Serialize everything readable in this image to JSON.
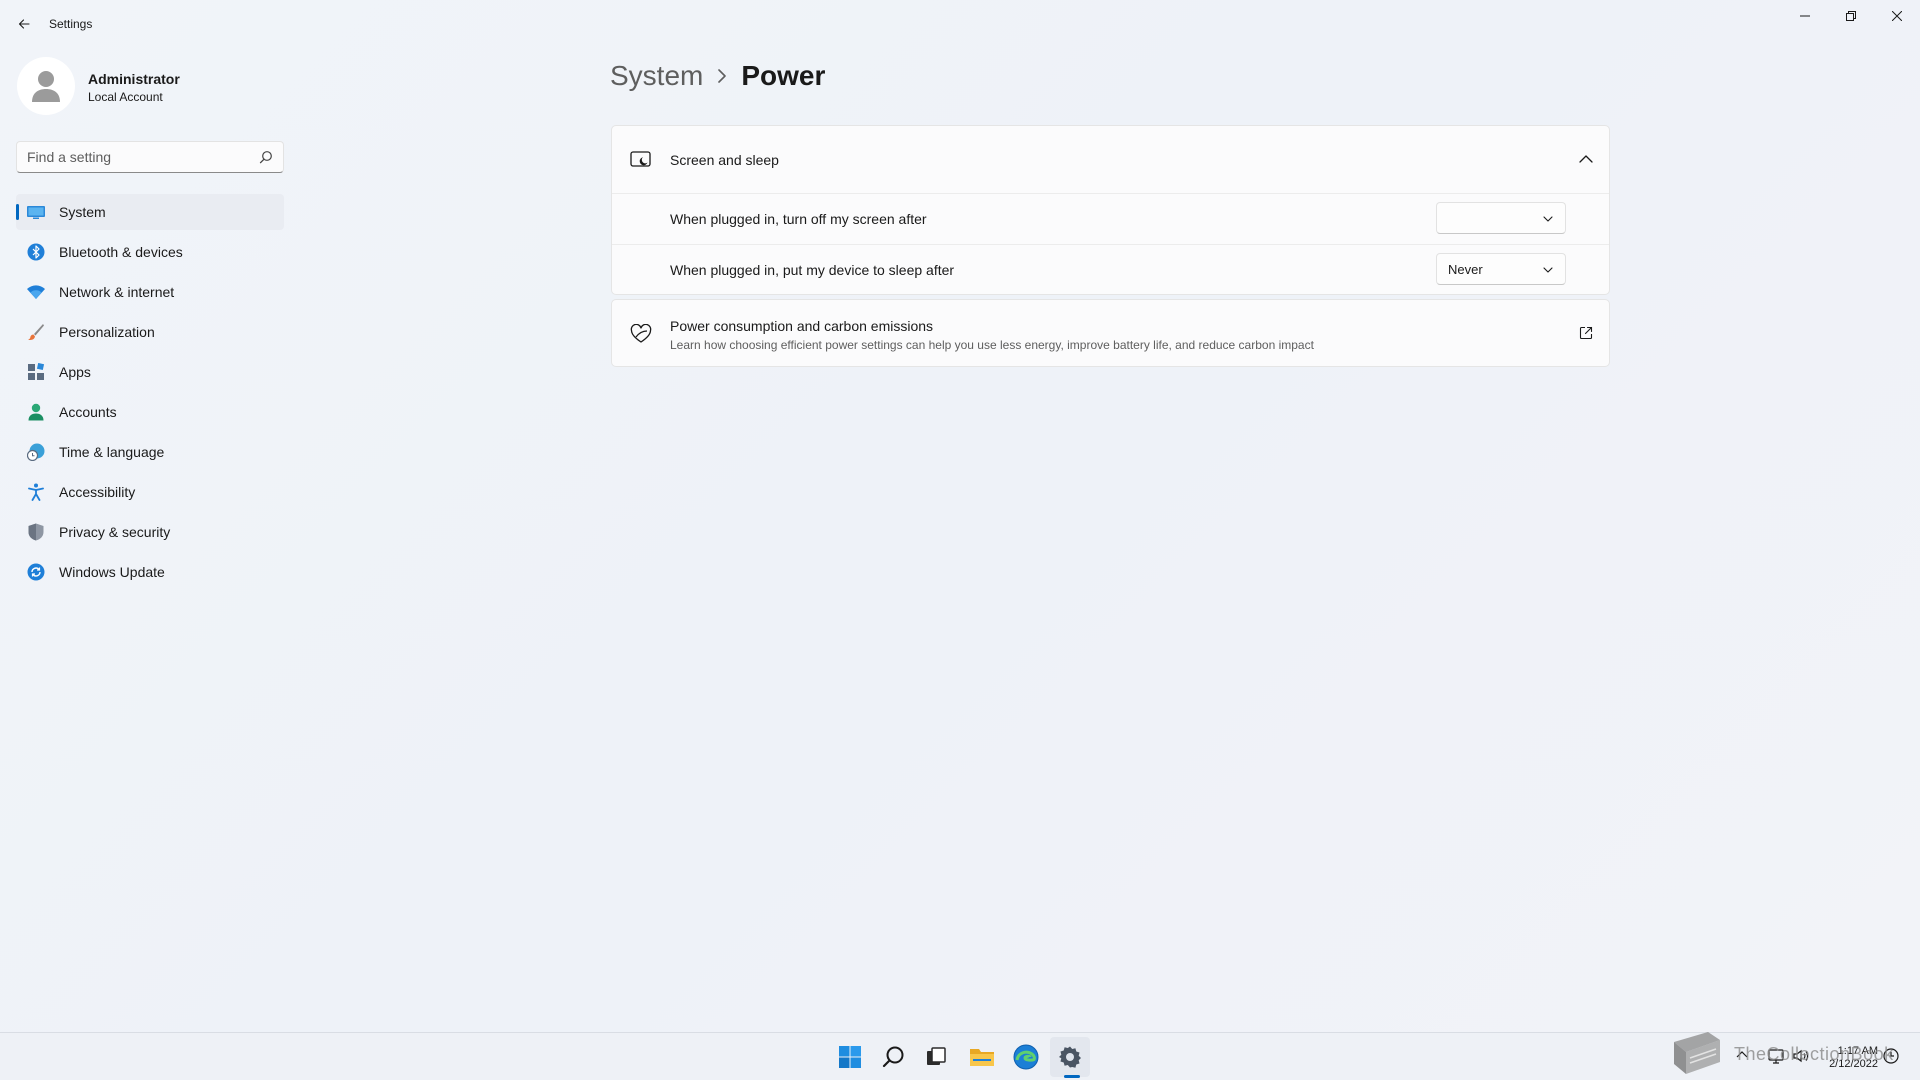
{
  "titlebar": {
    "app_title": "Settings"
  },
  "user": {
    "name": "Administrator",
    "account_type": "Local Account"
  },
  "search": {
    "placeholder": "Find a setting"
  },
  "sidebar": {
    "items": [
      {
        "label": "System",
        "icon": "system-icon",
        "selected": true
      },
      {
        "label": "Bluetooth & devices",
        "icon": "bluetooth-icon"
      },
      {
        "label": "Network & internet",
        "icon": "wifi-icon"
      },
      {
        "label": "Personalization",
        "icon": "brush-icon"
      },
      {
        "label": "Apps",
        "icon": "apps-icon"
      },
      {
        "label": "Accounts",
        "icon": "accounts-icon"
      },
      {
        "label": "Time & language",
        "icon": "globe-clock-icon"
      },
      {
        "label": "Accessibility",
        "icon": "accessibility-icon"
      },
      {
        "label": "Privacy & security",
        "icon": "shield-icon"
      },
      {
        "label": "Windows Update",
        "icon": "update-icon"
      }
    ]
  },
  "breadcrumb": {
    "parent": "System",
    "current": "Power"
  },
  "screen_sleep": {
    "title": "Screen and sleep",
    "expanded": true,
    "rows": [
      {
        "label": "When plugged in, turn off my screen after",
        "value": ""
      },
      {
        "label": "When plugged in, put my device to sleep after",
        "value": "Never"
      }
    ]
  },
  "power_consumption": {
    "title": "Power consumption and carbon emissions",
    "description": "Learn how choosing efficient power settings can help you use less energy, improve battery life, and reduce carbon impact"
  },
  "taskbar": {
    "apps": [
      "start-icon",
      "search-icon",
      "task-view-icon",
      "file-explorer-icon",
      "edge-icon",
      "settings-icon"
    ],
    "active_app": "settings-icon"
  },
  "clock": {
    "time": "1:17 AM",
    "date": "2/12/2022"
  },
  "watermark": {
    "text": "TheCollectionBook"
  },
  "colors": {
    "accent": "#0067c0",
    "background": "#f0f3f9",
    "card": "#fbfbfc"
  }
}
